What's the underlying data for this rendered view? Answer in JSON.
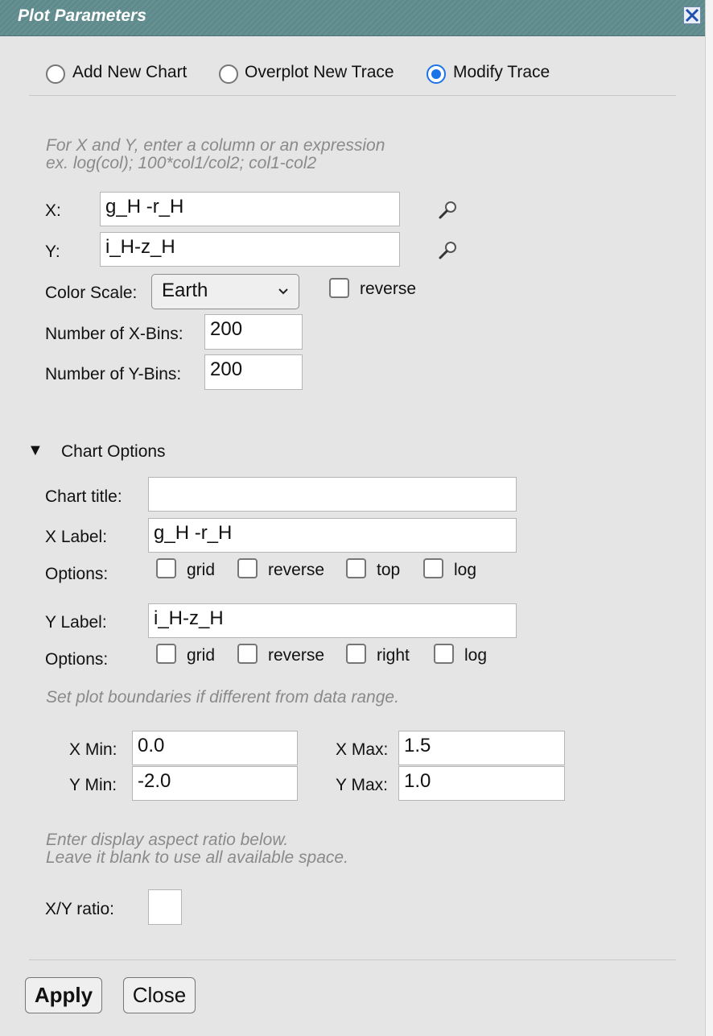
{
  "dialog": {
    "title": "Plot Parameters"
  },
  "mode": {
    "options": [
      "Add New Chart",
      "Overplot New Trace",
      "Modify Trace"
    ],
    "selected": "Modify Trace"
  },
  "hint_xy": [
    "For X and Y, enter a column or an expression",
    "ex. log(col); 100*col1/col2; col1-col2"
  ],
  "x": {
    "label": "X:",
    "value": "g_H -r_H"
  },
  "y": {
    "label": "Y:",
    "value": "i_H-z_H"
  },
  "color_scale": {
    "label": "Color Scale:",
    "value": "Earth",
    "reverse_label": "reverse",
    "reverse_checked": false
  },
  "xbins": {
    "label": "Number of X-Bins:",
    "value": "200"
  },
  "ybins": {
    "label": "Number of Y-Bins:",
    "value": "200"
  },
  "chart_options": {
    "toggle": "▼",
    "header": "Chart Options",
    "title_label": "Chart title:",
    "title_value": "",
    "xlabel_label": "X Label:",
    "xlabel_value": "g_H -r_H",
    "options_label": "Options:",
    "x_options": [
      "grid",
      "reverse",
      "top",
      "log"
    ],
    "ylabel_label": "Y Label:",
    "ylabel_value": "i_H-z_H",
    "y_options": [
      "grid",
      "reverse",
      "right",
      "log"
    ]
  },
  "bounds": {
    "hint": "Set plot boundaries if different from data range.",
    "xmin_label": "X Min:",
    "xmin": "0.0",
    "xmax_label": "X Max:",
    "xmax": "1.5",
    "ymin_label": "Y Min:",
    "ymin": "-2.0",
    "ymax_label": "Y Max:",
    "ymax": "1.0"
  },
  "aspect": {
    "hint": [
      "Enter display aspect ratio below.",
      "Leave it blank to use all available space."
    ],
    "label": "X/Y ratio:",
    "value": ""
  },
  "buttons": {
    "apply": "Apply",
    "close": "Close"
  },
  "icons": {
    "close": "close-icon",
    "search": "magnifier-icon",
    "dropdown": "chevron-down-icon"
  }
}
